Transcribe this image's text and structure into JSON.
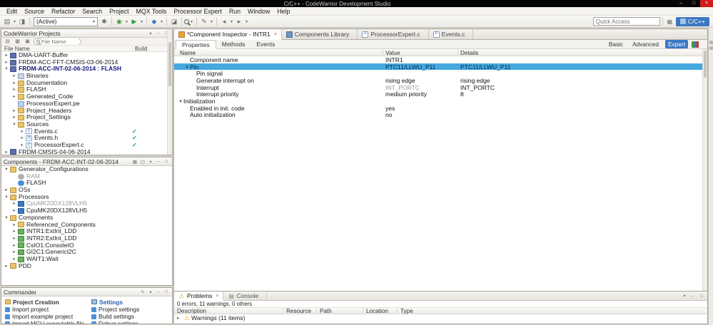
{
  "titlebar": {
    "title": "C/C++ - CodeWarrior Development Studio",
    "minimize_glyph": "–",
    "maximize_glyph": "□",
    "close_glyph": "×"
  },
  "menubar": {
    "items": [
      "Edit",
      "Source",
      "Refactor",
      "Search",
      "Project",
      "MQX Tools",
      "Processor Expert",
      "Run",
      "Window",
      "Help"
    ]
  },
  "toolbar": {
    "icons_a": [
      {
        "name": "new-wizard-icon",
        "glyph": "▤"
      },
      {
        "name": "new-dropdown-icon",
        "glyph": "▾",
        "classes": "narrow"
      },
      {
        "name": "save-icon",
        "glyph": "◨"
      },
      {
        "name": "sep",
        "sep": true
      }
    ],
    "config_combo": {
      "value": "(Active)",
      "arrow": "▾"
    },
    "icons_b": [
      {
        "name": "settings-icon",
        "glyph": "✱"
      },
      {
        "name": "sep",
        "sep": true
      },
      {
        "name": "debug-icon",
        "glyph": "◉",
        "color": "#3f9c35"
      },
      {
        "name": "debug-dropdown-icon",
        "glyph": "▾",
        "classes": "narrow"
      },
      {
        "name": "run-icon",
        "glyph": "▶",
        "color": "#2e9e3e"
      },
      {
        "name": "run-dropdown-icon",
        "glyph": "▾",
        "classes": "narrow"
      },
      {
        "name": "sep",
        "sep": true
      },
      {
        "name": "flash-programmer-icon",
        "glyph": "◆",
        "color": "#3a78c2"
      },
      {
        "name": "flash-dropdown-icon",
        "glyph": "▾",
        "classes": "narrow"
      },
      {
        "name": "sep",
        "sep": true
      },
      {
        "name": "build-icon",
        "glyph": "◪"
      },
      {
        "name": "sep",
        "sep": true
      },
      {
        "name": "search-icon",
        "glyph": "",
        "classes": "magnifier"
      },
      {
        "name": "search-dropdown-icon",
        "glyph": "▾",
        "classes": "narrow"
      },
      {
        "name": "sep",
        "sep": true
      },
      {
        "name": "annotation-icon",
        "glyph": "✎"
      },
      {
        "name": "annotation-dropdown-icon",
        "glyph": "▾",
        "classes": "narrow"
      },
      {
        "name": "sep",
        "sep": true
      },
      {
        "name": "back-icon",
        "glyph": "◂"
      },
      {
        "name": "back-dropdown-icon",
        "glyph": "▾",
        "classes": "narrow"
      },
      {
        "name": "forward-icon",
        "glyph": "▸"
      },
      {
        "name": "forward-dropdown-icon",
        "glyph": "▾",
        "classes": "narrow"
      }
    ],
    "quick_access_placeholder": "Quick Access",
    "perspective_label": "C/C++"
  },
  "projects": {
    "title": "CodeWarrior Projects",
    "head_icons": [
      {
        "name": "view-menu-icon",
        "glyph": "▾"
      },
      {
        "name": "minimize-view-icon",
        "glyph": "–"
      },
      {
        "name": "maximize-view-icon",
        "glyph": "□"
      }
    ],
    "filter_placeholder": "File Name",
    "columns": {
      "name": "File Name",
      "build": "Build"
    },
    "tree": [
      {
        "label": "DMA-UART-Buffer",
        "indent": 0,
        "arrow": "right",
        "icon": "project"
      },
      {
        "label": "FRDM-ACC-FFT-CMSIS-03-06-2014",
        "indent": 0,
        "arrow": "right",
        "icon": "project"
      },
      {
        "label": "FRDM-ACC-INT-02-06-2014 : FLASH",
        "indent": 0,
        "arrow": "down",
        "icon": "project",
        "classes": "bold-blue"
      },
      {
        "label": "Binaries",
        "indent": 1,
        "arrow": "right",
        "icon": "folder-bin"
      },
      {
        "label": "Documentation",
        "indent": 1,
        "arrow": "right",
        "icon": "folder"
      },
      {
        "label": "FLASH",
        "indent": 1,
        "arrow": "right",
        "icon": "folder"
      },
      {
        "label": "Generated_Code",
        "indent": 1,
        "arrow": "right",
        "icon": "folder"
      },
      {
        "label": "ProcessorExpert.pe",
        "indent": 1,
        "arrow": "none",
        "icon": "file-pe"
      },
      {
        "label": "Project_Headers",
        "indent": 1,
        "arrow": "right",
        "icon": "folder"
      },
      {
        "label": "Project_Settings",
        "indent": 1,
        "arrow": "right",
        "icon": "folder"
      },
      {
        "label": "Sources",
        "indent": 1,
        "arrow": "down",
        "icon": "folder"
      },
      {
        "label": "Events.c",
        "indent": 2,
        "arrow": "right",
        "icon": "file-c",
        "build": "✓"
      },
      {
        "label": "Events.h",
        "indent": 2,
        "arrow": "right",
        "icon": "file-h",
        "build": "✓"
      },
      {
        "label": "ProcessorExpert.c",
        "indent": 2,
        "arrow": "right",
        "icon": "file-c",
        "build": "✓"
      },
      {
        "label": "FRDM-CMSIS-04-06-2014",
        "indent": 0,
        "arrow": "right",
        "icon": "project"
      }
    ]
  },
  "components": {
    "title": "Components - FRDM-ACC-INT-02-06-2014",
    "head_icons": [
      {
        "name": "filter-icon",
        "glyph": "▦"
      },
      {
        "name": "collapse-all-icon",
        "glyph": "◫"
      },
      {
        "name": "view-menu-icon",
        "glyph": "▾"
      },
      {
        "name": "minimize-view-icon",
        "glyph": "–"
      },
      {
        "name": "maximize-view-icon",
        "glyph": "□"
      }
    ],
    "tree": [
      {
        "label": "Generator_Configurations",
        "indent": 0,
        "arrow": "down",
        "icon": "folder"
      },
      {
        "label": "RAM",
        "indent": 1,
        "arrow": "none",
        "icon": "gen-gray",
        "classes": "grayed"
      },
      {
        "label": "FLASH",
        "indent": 1,
        "arrow": "none",
        "icon": "gen"
      },
      {
        "label": "OSs",
        "indent": 0,
        "arrow": "right",
        "icon": "folder"
      },
      {
        "label": "Processors",
        "indent": 0,
        "arrow": "down",
        "icon": "folder"
      },
      {
        "label": "CpuMK20DX128VLH5",
        "indent": 1,
        "arrow": "right",
        "icon": "cpu",
        "classes": "grayed"
      },
      {
        "label": "CpuMK20DX128VLH5",
        "indent": 1,
        "arrow": "right",
        "icon": "cpu"
      },
      {
        "label": "Components",
        "indent": 0,
        "arrow": "down",
        "icon": "folder"
      },
      {
        "label": "Referenced_Components",
        "indent": 1,
        "arrow": "right",
        "icon": "folder"
      },
      {
        "label": "INTR1:ExtInt_LDD",
        "indent": 1,
        "arrow": "right",
        "icon": "comp"
      },
      {
        "label": "INTR2:ExtInt_LDD",
        "indent": 1,
        "arrow": "right",
        "icon": "comp"
      },
      {
        "label": "CsIO1:ConsoleIO",
        "indent": 1,
        "arrow": "right",
        "icon": "comp"
      },
      {
        "label": "GI2C1:GenericI2C",
        "indent": 1,
        "arrow": "right",
        "icon": "comp"
      },
      {
        "label": "WAIT1:Wait",
        "indent": 1,
        "arrow": "right",
        "icon": "comp"
      },
      {
        "label": "PDD",
        "indent": 0,
        "arrow": "right",
        "icon": "folder"
      }
    ]
  },
  "commander": {
    "title": "Commander",
    "head_icons": [
      {
        "name": "edit-icon",
        "glyph": "✎"
      },
      {
        "name": "view-menu-icon",
        "glyph": "▾"
      },
      {
        "name": "minimize-view-icon",
        "glyph": "–"
      },
      {
        "name": "maximize-view-icon",
        "glyph": "□"
      }
    ],
    "sections": [
      {
        "title": "Project Creation",
        "items": [
          "Import project",
          "Import example project",
          "Import MCU executable file"
        ]
      },
      {
        "title": "Settings",
        "items": [
          "Project settings",
          "Build settings",
          "Debug settings"
        ]
      }
    ]
  },
  "editor": {
    "tabs": [
      {
        "label": "*Component Inspector - INTR1",
        "icon": "inspector",
        "active": true,
        "close": "×"
      },
      {
        "label": "Components Library",
        "icon": "library"
      },
      {
        "label": "ProcessorExpert.c",
        "icon": "file-c"
      },
      {
        "label": "Events.c",
        "icon": "file-c"
      }
    ],
    "inspector": {
      "tabs": [
        {
          "label": "Properties",
          "active": true
        },
        {
          "label": "Methods"
        },
        {
          "label": "Events"
        }
      ],
      "modes": [
        {
          "label": "Basic"
        },
        {
          "label": "Advanced"
        },
        {
          "label": "Expert",
          "active": true
        }
      ],
      "columns": {
        "name": "Name",
        "value": "Value",
        "details": "Details"
      },
      "rows": [
        {
          "name": "Component name",
          "value": "INTR1",
          "details": "",
          "indent": 1,
          "arrow": "none"
        },
        {
          "name": "Pin",
          "value": "PTC11/LLWU_P11",
          "details": "PTC11/LLWU_P11",
          "indent": 1,
          "arrow": "down",
          "selected": true
        },
        {
          "name": "Pin signal",
          "value": "",
          "details": "",
          "indent": 2,
          "arrow": "none"
        },
        {
          "name": "Generate interrupt on",
          "value": "rising edge",
          "details": "rising edge",
          "indent": 2,
          "arrow": "none"
        },
        {
          "name": "Interrupt",
          "value": "INT_PORTC",
          "details": "INT_PORTC",
          "indent": 2,
          "arrow": "none",
          "value_gray": true
        },
        {
          "name": "Interrupt priority",
          "value": "medium priority",
          "details": "8",
          "indent": 2,
          "arrow": "none"
        },
        {
          "name": "Initialization",
          "value": "",
          "details": "",
          "indent": 0,
          "arrow": "down"
        },
        {
          "name": "Enabled in init. code",
          "value": "yes",
          "details": "",
          "indent": 1,
          "arrow": "none"
        },
        {
          "name": "Auto initialization",
          "value": "no",
          "details": "",
          "indent": 1,
          "arrow": "none"
        }
      ]
    }
  },
  "problems": {
    "tabs": [
      {
        "label": "Problems",
        "icon": "problems",
        "active": true,
        "close": "×"
      },
      {
        "label": "Console",
        "icon": "console"
      }
    ],
    "head_icons": [
      {
        "name": "view-menu-icon",
        "glyph": "▾"
      },
      {
        "name": "minimize-view-icon",
        "glyph": "–"
      },
      {
        "name": "maximize-view-icon",
        "glyph": "□"
      }
    ],
    "summary": "0 errors, 11 warnings, 0 others",
    "columns": [
      "Description",
      "Resource",
      "Path",
      "Location",
      "Type"
    ],
    "rows": [
      {
        "label": "Warnings (11 items)",
        "arrow": "right",
        "warn": "⚠"
      }
    ]
  }
}
